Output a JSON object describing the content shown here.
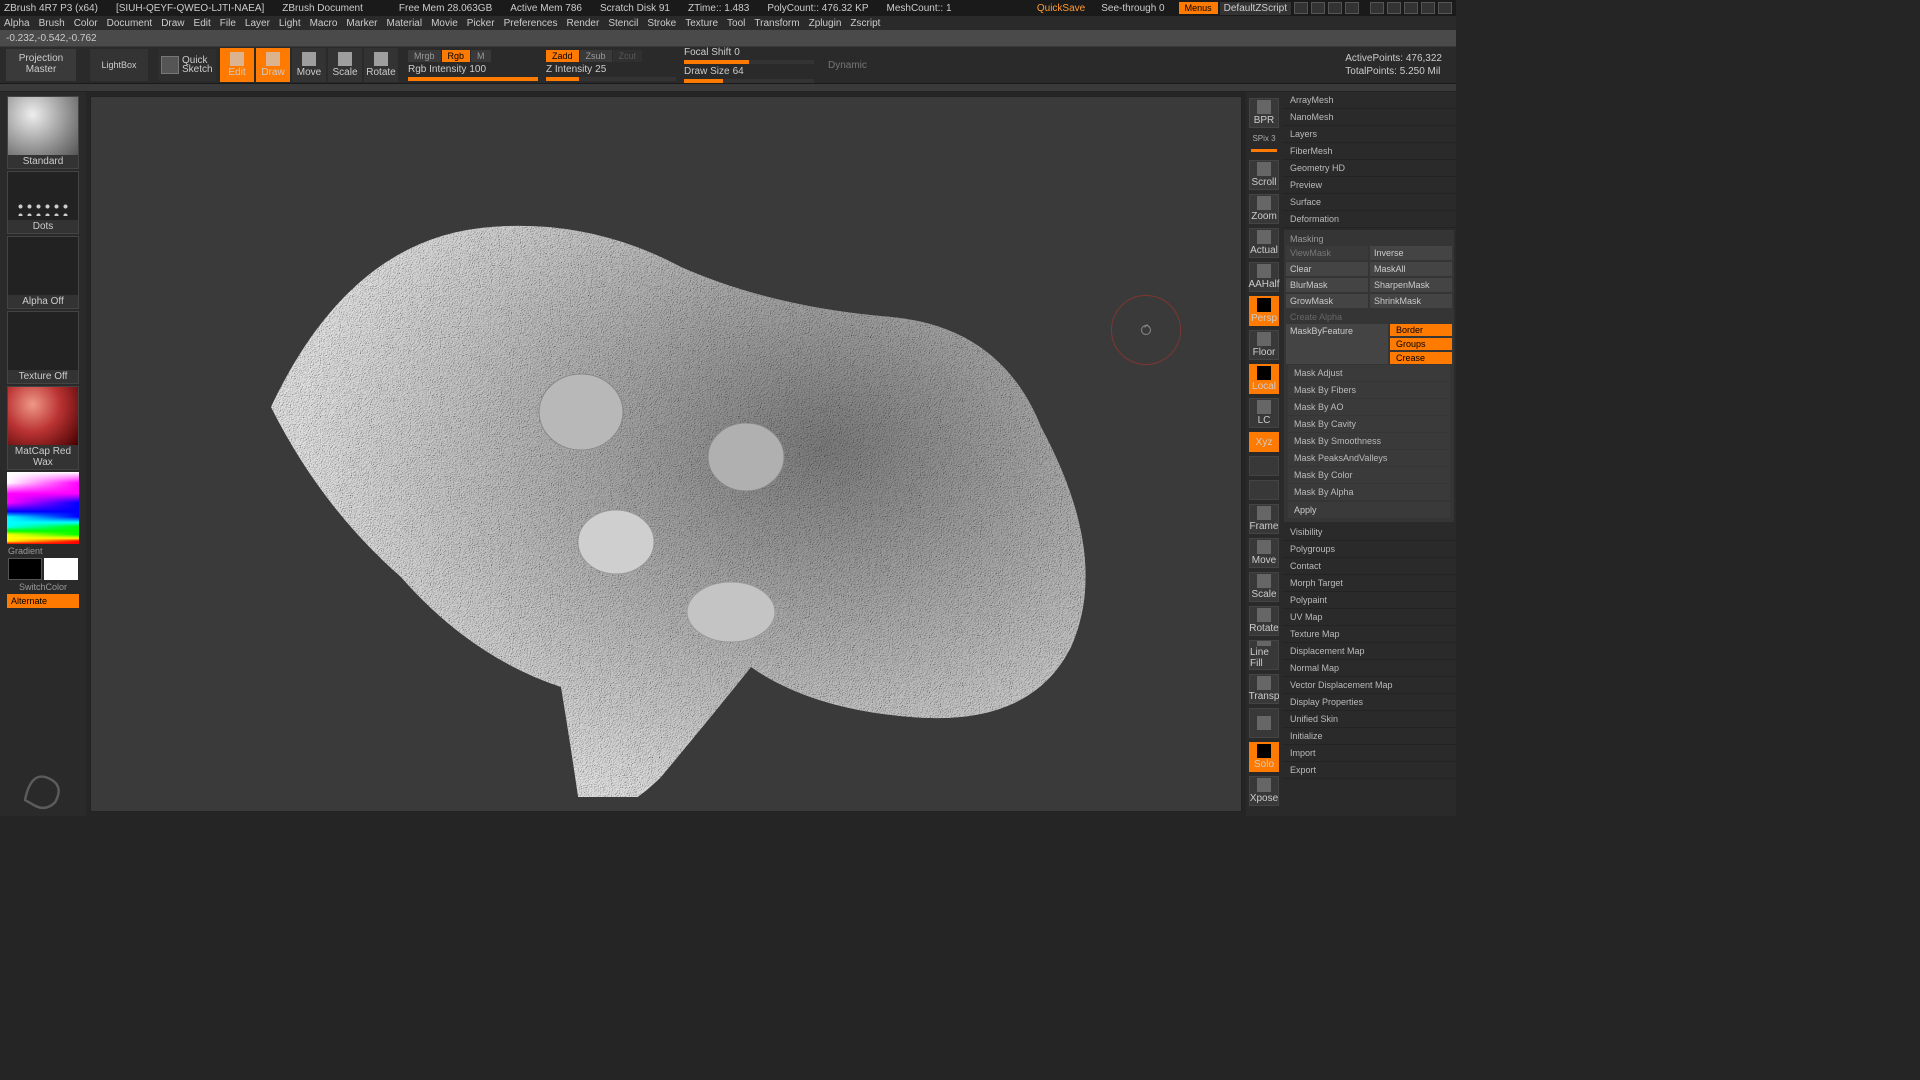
{
  "titlebar": {
    "app": "ZBrush 4R7 P3 (x64)",
    "project": "[SIUH-QEYF-QWEO-LJTI-NAEA]",
    "doc": "ZBrush Document",
    "freemem": "Free Mem  28.063GB",
    "activemem": "Active Mem  786",
    "scratch": "Scratch Disk  91",
    "ztime": "ZTime::  1.483",
    "polycount": "PolyCount::  476.32 KP",
    "meshcount": "MeshCount::  1",
    "quicksave": "QuickSave",
    "seethrough": "See-through  0",
    "menus": "Menus",
    "script": "DefaultZScript"
  },
  "menus": [
    "Alpha",
    "Brush",
    "Color",
    "Document",
    "Draw",
    "Edit",
    "File",
    "Layer",
    "Light",
    "Macro",
    "Marker",
    "Material",
    "Movie",
    "Picker",
    "Preferences",
    "Render",
    "Stencil",
    "Stroke",
    "Texture",
    "Tool",
    "Transform",
    "Zplugin",
    "Zscript"
  ],
  "coords": "-0.232,-0.542,-0.762",
  "toolbar": {
    "projection": "Projection\nMaster",
    "lightbox": "LightBox",
    "quicksketch": "Quick\nSketch",
    "modes": [
      "Edit",
      "Draw",
      "Move",
      "Scale",
      "Rotate"
    ],
    "mrgb_row": {
      "mrgb": "Mrgb",
      "rgb": "Rgb",
      "m": "M"
    },
    "rgb_intensity_lbl": "Rgb Intensity",
    "rgb_intensity_val": "100",
    "zrow": {
      "zadd": "Zadd",
      "zsub": "Zsub",
      "zcut": "Zcut"
    },
    "z_intensity_lbl": "Z Intensity",
    "z_intensity_val": "25",
    "focal_lbl": "Focal Shift",
    "focal_val": "0",
    "draw_lbl": "Draw Size",
    "draw_val": "64",
    "dynamic": "Dynamic",
    "active_pts": "ActivePoints:  476,322",
    "total_pts": "TotalPoints:  5.250 Mil"
  },
  "left": {
    "brush": "Standard",
    "stroke": "Dots",
    "alpha": "Alpha Off",
    "texture": "Texture Off",
    "material": "MatCap Red Wax",
    "gradient": "Gradient",
    "switch": "SwitchColor",
    "alternate": "Alternate"
  },
  "nav": {
    "spix": "SPix 3",
    "items": [
      {
        "l": "BPR"
      },
      {
        "l": "Scroll"
      },
      {
        "l": "Zoom"
      },
      {
        "l": "Actual"
      },
      {
        "l": "AAHalf"
      },
      {
        "l": "Persp",
        "a": true
      },
      {
        "l": "Floor"
      },
      {
        "l": "Local",
        "a": true
      },
      {
        "l": "LC"
      },
      {
        "l": "Xyz",
        "a": true,
        "thin": true
      },
      {
        "l": "",
        "thin": true
      },
      {
        "l": "",
        "thin": true
      },
      {
        "l": "Frame"
      },
      {
        "l": "Move"
      },
      {
        "l": "Scale"
      },
      {
        "l": "Rotate"
      },
      {
        "l": "Line Fill"
      },
      {
        "l": "Transp"
      },
      {
        "l": ""
      },
      {
        "l": "Solo",
        "a": true
      },
      {
        "l": "Xpose"
      }
    ]
  },
  "right": {
    "pre_sections": [
      "ArrayMesh",
      "NanoMesh",
      "Layers",
      "FiberMesh",
      "Geometry HD",
      "Preview",
      "Surface",
      "Deformation"
    ],
    "mask": {
      "header": "Masking",
      "r1": [
        "ViewMask",
        "Inverse"
      ],
      "r2": [
        "Clear",
        "MaskAll"
      ],
      "r3": [
        "BlurMask",
        "SharpenMask"
      ],
      "r4": [
        "GrowMask",
        "ShrinkMask"
      ],
      "create_alpha": "Create Alpha",
      "mbf": "MaskByFeature",
      "border": "Border",
      "groups": "Groups",
      "crease": "Crease",
      "subs": [
        "Mask Adjust",
        "Mask By Fibers",
        "Mask By AO",
        "Mask By Cavity",
        "Mask By Smoothness",
        "Mask PeaksAndValleys",
        "Mask By Color",
        "Mask By Alpha"
      ],
      "apply": "Apply"
    },
    "post_sections": [
      "Visibility",
      "Polygroups",
      "Contact",
      "Morph Target",
      "Polypaint",
      "UV Map",
      "Texture Map",
      "Displacement Map",
      "Normal Map",
      "Vector Displacement Map",
      "Display Properties",
      "Unified Skin",
      "Initialize",
      "Import",
      "Export"
    ]
  }
}
